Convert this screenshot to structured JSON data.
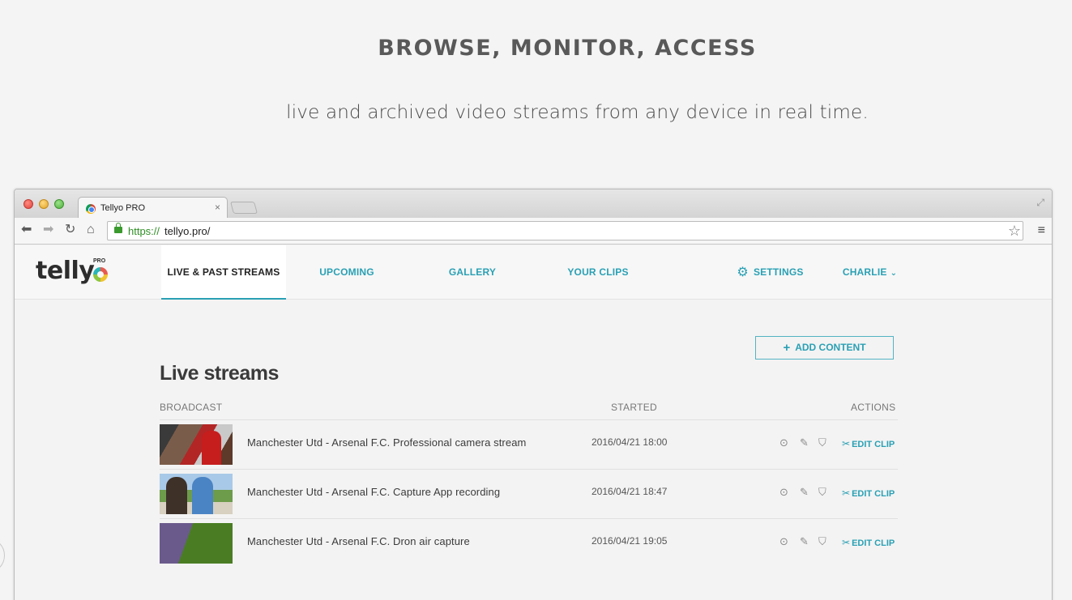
{
  "hero": {
    "title": "BROWSE,  MONITOR,  ACCESS",
    "subtitle": "live and archived video streams from any device in real time."
  },
  "browser": {
    "tab_title": "Tellyo PRO",
    "tab_close": "×",
    "url_scheme": "https://",
    "url_rest": "tellyo.pro/",
    "icons": [
      "back-icon",
      "forward-icon",
      "reload-icon",
      "home-icon",
      "lock-icon",
      "star-icon",
      "menu-icon",
      "fullscreen-icon"
    ]
  },
  "app": {
    "logo_text": "telly",
    "logo_badge": "PRO",
    "nav": {
      "live": "LIVE & PAST STREAMS",
      "upcoming": "UPCOMING",
      "gallery": "GALLERY",
      "clips": "YOUR CLIPS",
      "settings": "SETTINGS",
      "user": "CHARLIE"
    },
    "accent_color": "#2aa0b4",
    "add_button": "ADD CONTENT",
    "section_title": "Live streams",
    "columns": [
      "BROADCAST",
      "STARTED",
      "ACTIONS"
    ],
    "edit_clip_label": "EDIT CLIP",
    "rows": [
      {
        "title": "Manchester Utd - Arsenal F.C.  Professional camera stream",
        "started": "2016/04/21  18:00"
      },
      {
        "title": "Manchester Utd - Arsenal F.C.  Capture App recording",
        "started": "2016/04/21  18:47"
      },
      {
        "title": "Manchester Utd - Arsenal F.C.  Dron air capture",
        "started": "2016/04/21  19:05"
      }
    ]
  }
}
